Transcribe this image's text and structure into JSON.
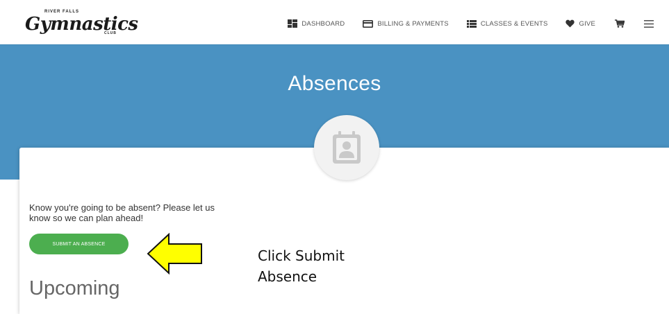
{
  "logo": {
    "top_text": "RIVER FALLS",
    "script_text": "Gymnastics",
    "bottom_text": "CLUB"
  },
  "nav": {
    "dashboard": "DASHBOARD",
    "billing": "BILLING & PAYMENTS",
    "classes": "CLASSES & EVENTS",
    "give": "GIVE",
    "icons": [
      "dashboard-icon",
      "card-icon",
      "list-icon",
      "heart-icon",
      "cart-icon",
      "menu-icon"
    ]
  },
  "page": {
    "title": "Absences",
    "intro": "Know you're going to be absent? Please let us know so we can plan ahead!",
    "submit_label": "SUBMIT AN ABSENCE",
    "upcoming_heading": "Upcoming"
  },
  "annotation": {
    "text": "Click Submit Absence"
  },
  "colors": {
    "band": "#4a92c2",
    "button": "#4cae4f",
    "arrow_fill": "#ffff00"
  }
}
